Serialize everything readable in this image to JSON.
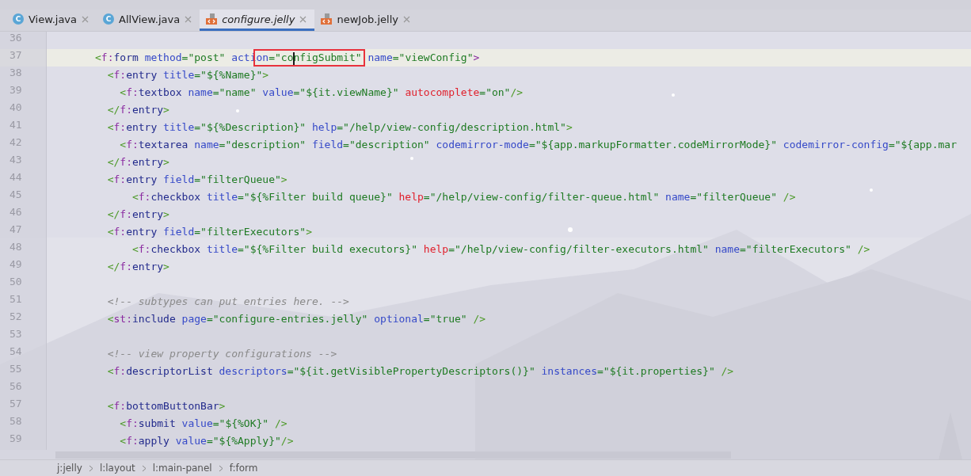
{
  "tabs": [
    {
      "label": "View.java",
      "kind": "java",
      "icon_text": "C",
      "selected": false
    },
    {
      "label": "AllView.java",
      "kind": "java",
      "icon_text": "C",
      "selected": false
    },
    {
      "label": "configure.jelly",
      "kind": "jelly",
      "selected": true
    },
    {
      "label": "newJob.jelly",
      "kind": "jelly",
      "selected": false
    }
  ],
  "editor": {
    "lines": [
      {
        "number": "36",
        "current": false
      },
      {
        "number": "37",
        "current": true,
        "tokens": [
          {
            "kind": "punct",
            "text": "<"
          },
          {
            "kind": "ns",
            "text": "f:"
          },
          {
            "kind": "tag",
            "text": "form "
          },
          {
            "kind": "attr",
            "text": "method"
          },
          {
            "kind": "str",
            "text": "=\"post\" "
          },
          {
            "kind": "attr",
            "text": "acti"
          },
          {
            "kind": "attr",
            "text": "on",
            "boxed": true
          },
          {
            "kind": "str",
            "text": "=\"co",
            "boxed": true,
            "caret": true
          },
          {
            "kind": "str",
            "text": "nfigSubmit\"",
            "boxed": true
          },
          {
            "kind": "attr",
            "text": " name"
          },
          {
            "kind": "str",
            "text": "=\"viewConfig\""
          },
          {
            "kind": "ns",
            "text": ">"
          }
        ]
      },
      {
        "number": "38",
        "current": false,
        "tokens": [
          {
            "kind": "punct",
            "text": "  <"
          },
          {
            "kind": "ns",
            "text": "f:"
          },
          {
            "kind": "tag",
            "text": "entry "
          },
          {
            "kind": "attr",
            "text": "title"
          },
          {
            "kind": "str",
            "text": "=\"${%Name}\""
          },
          {
            "kind": "punct",
            "text": ">"
          }
        ]
      },
      {
        "number": "39",
        "current": false,
        "tokens": [
          {
            "kind": "punct",
            "text": "    <"
          },
          {
            "kind": "ns",
            "text": "f:"
          },
          {
            "kind": "tag",
            "text": "textbox "
          },
          {
            "kind": "attr",
            "text": "name"
          },
          {
            "kind": "str",
            "text": "=\"name\" "
          },
          {
            "kind": "attr",
            "text": "value"
          },
          {
            "kind": "str",
            "text": "=\"${it.viewName}\" "
          },
          {
            "kind": "bad",
            "text": "autocomplete"
          },
          {
            "kind": "str",
            "text": "=\"on\""
          },
          {
            "kind": "punct",
            "text": "/>"
          }
        ]
      },
      {
        "number": "40",
        "current": false,
        "tokens": [
          {
            "kind": "punct",
            "text": "  </"
          },
          {
            "kind": "ns",
            "text": "f:"
          },
          {
            "kind": "tag",
            "text": "entry"
          },
          {
            "kind": "punct",
            "text": ">"
          }
        ]
      },
      {
        "number": "41",
        "current": false,
        "tokens": [
          {
            "kind": "punct",
            "text": "  <"
          },
          {
            "kind": "ns",
            "text": "f:"
          },
          {
            "kind": "tag",
            "text": "entry "
          },
          {
            "kind": "attr",
            "text": "title"
          },
          {
            "kind": "str",
            "text": "=\"${%Description}\" "
          },
          {
            "kind": "attr",
            "text": "help"
          },
          {
            "kind": "str",
            "text": "=\"/help/view-config/description.html\""
          },
          {
            "kind": "punct",
            "text": ">"
          }
        ]
      },
      {
        "number": "42",
        "current": false,
        "tokens": [
          {
            "kind": "punct",
            "text": "    <"
          },
          {
            "kind": "ns",
            "text": "f:"
          },
          {
            "kind": "tag",
            "text": "textarea "
          },
          {
            "kind": "attr",
            "text": "name"
          },
          {
            "kind": "str",
            "text": "=\"description\" "
          },
          {
            "kind": "attr",
            "text": "field"
          },
          {
            "kind": "str",
            "text": "=\"description\" "
          },
          {
            "kind": "attr",
            "text": "codemirror-mode"
          },
          {
            "kind": "str",
            "text": "=\"${app.markupFormatter.codeMirrorMode}\" "
          },
          {
            "kind": "attr",
            "text": "codemirror-config"
          },
          {
            "kind": "str",
            "text": "=\"${app.mar"
          }
        ]
      },
      {
        "number": "43",
        "current": false,
        "tokens": [
          {
            "kind": "punct",
            "text": "  </"
          },
          {
            "kind": "ns",
            "text": "f:"
          },
          {
            "kind": "tag",
            "text": "entry"
          },
          {
            "kind": "punct",
            "text": ">"
          }
        ]
      },
      {
        "number": "44",
        "current": false,
        "tokens": [
          {
            "kind": "punct",
            "text": "  <"
          },
          {
            "kind": "ns",
            "text": "f:"
          },
          {
            "kind": "tag",
            "text": "entry "
          },
          {
            "kind": "attr",
            "text": "field"
          },
          {
            "kind": "str",
            "text": "=\"filterQueue\""
          },
          {
            "kind": "punct",
            "text": ">"
          }
        ]
      },
      {
        "number": "45",
        "current": false,
        "tokens": [
          {
            "kind": "punct",
            "text": "      <"
          },
          {
            "kind": "ns",
            "text": "f:"
          },
          {
            "kind": "tag",
            "text": "checkbox "
          },
          {
            "kind": "attr",
            "text": "title"
          },
          {
            "kind": "str",
            "text": "=\"${%Filter build queue}\" "
          },
          {
            "kind": "bad",
            "text": "help"
          },
          {
            "kind": "str",
            "text": "=\"/help/view-config/filter-queue.html\" "
          },
          {
            "kind": "attr",
            "text": "name"
          },
          {
            "kind": "str",
            "text": "=\"filterQueue\" "
          },
          {
            "kind": "punct",
            "text": "/>"
          }
        ]
      },
      {
        "number": "46",
        "current": false,
        "tokens": [
          {
            "kind": "punct",
            "text": "  </"
          },
          {
            "kind": "ns",
            "text": "f:"
          },
          {
            "kind": "tag",
            "text": "entry"
          },
          {
            "kind": "punct",
            "text": ">"
          }
        ]
      },
      {
        "number": "47",
        "current": false,
        "tokens": [
          {
            "kind": "punct",
            "text": "  <"
          },
          {
            "kind": "ns",
            "text": "f:"
          },
          {
            "kind": "tag",
            "text": "entry "
          },
          {
            "kind": "attr",
            "text": "field"
          },
          {
            "kind": "str",
            "text": "=\"filterExecutors\""
          },
          {
            "kind": "punct",
            "text": ">"
          }
        ]
      },
      {
        "number": "48",
        "current": false,
        "tokens": [
          {
            "kind": "punct",
            "text": "      <"
          },
          {
            "kind": "ns",
            "text": "f:"
          },
          {
            "kind": "tag",
            "text": "checkbox "
          },
          {
            "kind": "attr",
            "text": "title"
          },
          {
            "kind": "str",
            "text": "=\"${%Filter build executors}\" "
          },
          {
            "kind": "bad",
            "text": "help"
          },
          {
            "kind": "str",
            "text": "=\"/help/view-config/filter-executors.html\" "
          },
          {
            "kind": "attr",
            "text": "name"
          },
          {
            "kind": "str",
            "text": "=\"filterExecutors\" "
          },
          {
            "kind": "punct",
            "text": "/>"
          }
        ]
      },
      {
        "number": "49",
        "current": false,
        "tokens": [
          {
            "kind": "punct",
            "text": "  </"
          },
          {
            "kind": "ns",
            "text": "f:"
          },
          {
            "kind": "tag",
            "text": "entry"
          },
          {
            "kind": "punct",
            "text": ">"
          }
        ]
      },
      {
        "number": "50",
        "current": false
      },
      {
        "number": "51",
        "current": false,
        "tokens": [
          {
            "kind": "comment",
            "text": "  <!-- subtypes can put entries here. -->"
          }
        ]
      },
      {
        "number": "52",
        "current": false,
        "tokens": [
          {
            "kind": "punct",
            "text": "  <"
          },
          {
            "kind": "ns",
            "text": "st:"
          },
          {
            "kind": "tag",
            "text": "include "
          },
          {
            "kind": "attr",
            "text": "page"
          },
          {
            "kind": "str",
            "text": "=\"configure-entries.jelly\" "
          },
          {
            "kind": "attr",
            "text": "optional"
          },
          {
            "kind": "str",
            "text": "=\"true\" "
          },
          {
            "kind": "punct",
            "text": "/>"
          }
        ]
      },
      {
        "number": "53",
        "current": false
      },
      {
        "number": "54",
        "current": false,
        "tokens": [
          {
            "kind": "comment",
            "text": "  <!-- view property configurations -->"
          }
        ]
      },
      {
        "number": "55",
        "current": false,
        "tokens": [
          {
            "kind": "punct",
            "text": "  <"
          },
          {
            "kind": "ns",
            "text": "f:"
          },
          {
            "kind": "tag",
            "text": "descriptorList "
          },
          {
            "kind": "attr",
            "text": "descriptors"
          },
          {
            "kind": "str",
            "text": "=\"${it.getVisiblePropertyDescriptors()}\" "
          },
          {
            "kind": "attr",
            "text": "instances"
          },
          {
            "kind": "str",
            "text": "=\"${it.properties}\" "
          },
          {
            "kind": "punct",
            "text": "/>"
          }
        ]
      },
      {
        "number": "56",
        "current": false
      },
      {
        "number": "57",
        "current": false,
        "tokens": [
          {
            "kind": "punct",
            "text": "  <"
          },
          {
            "kind": "ns",
            "text": "f:"
          },
          {
            "kind": "tag",
            "text": "bottomButtonBar"
          },
          {
            "kind": "punct",
            "text": ">"
          }
        ]
      },
      {
        "number": "58",
        "current": false,
        "tokens": [
          {
            "kind": "punct",
            "text": "    <"
          },
          {
            "kind": "ns",
            "text": "f:"
          },
          {
            "kind": "tag",
            "text": "submit "
          },
          {
            "kind": "attr",
            "text": "value"
          },
          {
            "kind": "str",
            "text": "=\"${%OK}\" "
          },
          {
            "kind": "punct",
            "text": "/>"
          }
        ]
      },
      {
        "number": "59",
        "current": false,
        "tokens": [
          {
            "kind": "punct",
            "text": "    <"
          },
          {
            "kind": "ns",
            "text": "f:"
          },
          {
            "kind": "tag",
            "text": "apply "
          },
          {
            "kind": "attr",
            "text": "value"
          },
          {
            "kind": "str",
            "text": "=\"${%Apply}\""
          },
          {
            "kind": "punct",
            "text": "/>"
          }
        ]
      }
    ]
  },
  "breadcrumbs": [
    "j:jelly",
    "l:layout",
    "l:main-panel",
    "f:form"
  ]
}
